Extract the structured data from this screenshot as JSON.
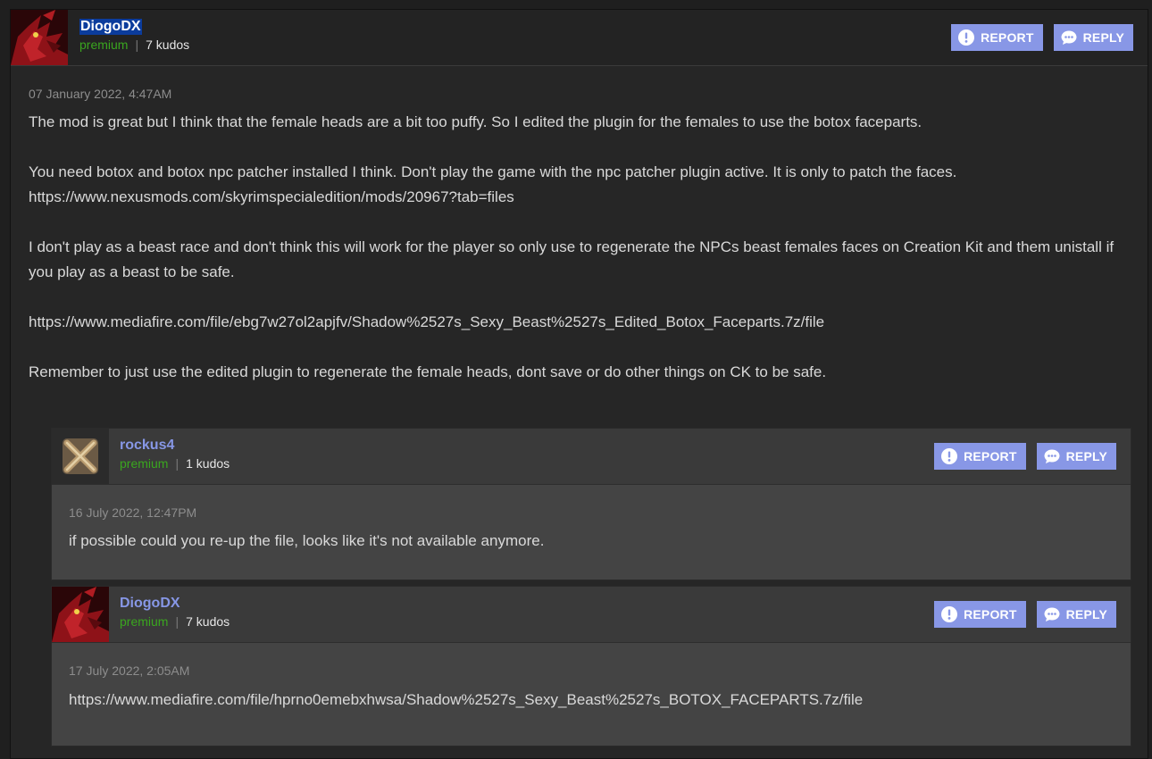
{
  "comments": [
    {
      "username": "DiogoDX",
      "membership": "premium",
      "kudos": "7 kudos",
      "date": "07 January 2022, 4:47AM",
      "paragraphs": [
        "The mod is great but I think that the female heads are a bit too puffy. So I edited the plugin for the females to use the botox faceparts.",
        "You need botox and botox npc patcher installed I think. Don't play the game with the npc patcher plugin active. It is only to patch the faces.",
        "https://www.nexusmods.com/skyrimspecialedition/mods/20967?tab=files",
        "I don't play as a beast race and don't think this will work for the player so only use to regenerate the NPCs beast females faces on Creation Kit and them unistall if you play as a beast to be safe.",
        "https://www.mediafire.com/file/ebg7w27ol2apjfv/Shadow%2527s_Sexy_Beast%2527s_Edited_Botox_Faceparts.7z/file",
        "Remember to just use the edited plugin to regenerate the female heads, dont save or do other things on CK to be safe."
      ]
    },
    {
      "username": "rockus4",
      "membership": "premium",
      "kudos": "1 kudos",
      "date": "16 July 2022, 12:47PM",
      "text": "if possible could you re-up the file, looks like it's not available anymore."
    },
    {
      "username": "DiogoDX",
      "membership": "premium",
      "kudos": "7 kudos",
      "date": "17 July 2022, 2:05AM",
      "text": "https://www.mediafire.com/file/hprno0emebxhwsa/Shadow%2527s_Sexy_Beast%2527s_BOTOX_FACEPARTS.7z/file"
    }
  ],
  "buttons": {
    "report": "REPORT",
    "reply": "REPLY",
    "separator": "|"
  },
  "colors": {
    "accent": "#8897e6",
    "premium": "#3aa61f",
    "username_link": "#8797e6"
  }
}
